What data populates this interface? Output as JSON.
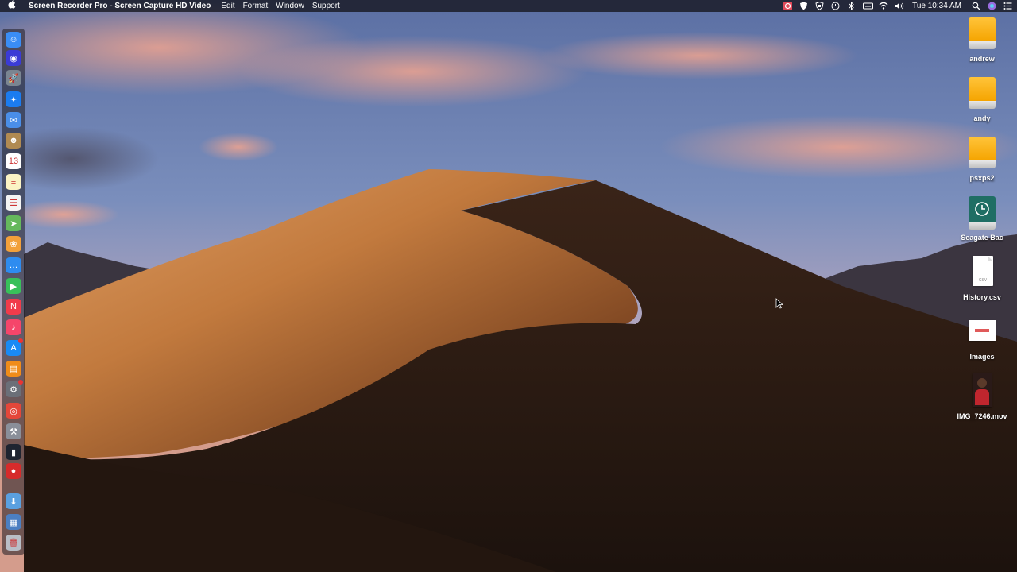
{
  "menubar": {
    "apple_icon": "apple-logo",
    "app_name": "Screen Recorder Pro - Screen Capture HD Video",
    "menus": [
      "Edit",
      "Format",
      "Window",
      "Support"
    ],
    "clock": "Tue 10:34 AM",
    "status_icons": [
      "screen-recorder-icon",
      "shield-icon",
      "vpn-icon",
      "time-machine-icon",
      "bluetooth-icon",
      "keyboard-icon",
      "wifi-icon",
      "volume-icon",
      "search-icon",
      "siri-icon",
      "notification-center-icon"
    ]
  },
  "dock": {
    "items": [
      {
        "name": "finder-icon",
        "color": "#3a8df5",
        "glyph": "☺"
      },
      {
        "name": "siri-icon",
        "color": "#3b3bd6",
        "glyph": "◉"
      },
      {
        "name": "launchpad-icon",
        "color": "#7a8591",
        "glyph": "🚀"
      },
      {
        "name": "safari-icon",
        "color": "#1b7cf0",
        "glyph": "✦"
      },
      {
        "name": "mail-icon",
        "color": "#4a8ee8",
        "glyph": "✉"
      },
      {
        "name": "contacts-icon",
        "color": "#b08a52",
        "glyph": "☻"
      },
      {
        "name": "calendar-icon",
        "color": "#ffffff",
        "glyph": "13"
      },
      {
        "name": "notes-icon",
        "color": "#fbf3c4",
        "glyph": "≡"
      },
      {
        "name": "reminders-icon",
        "color": "#f4f4f4",
        "glyph": "☰"
      },
      {
        "name": "maps-icon",
        "color": "#65b85c",
        "glyph": "➤"
      },
      {
        "name": "photos-icon",
        "color": "#f2a03a",
        "glyph": "❀"
      },
      {
        "name": "messages-icon",
        "color": "#2e8cf0",
        "glyph": "…"
      },
      {
        "name": "facetime-icon",
        "color": "#38c05a",
        "glyph": "▶"
      },
      {
        "name": "news-icon",
        "color": "#f13b4b",
        "glyph": "N"
      },
      {
        "name": "music-icon",
        "color": "#f5456a",
        "glyph": "♪"
      },
      {
        "name": "app-store-icon",
        "color": "#1a8af5",
        "glyph": "A"
      },
      {
        "name": "books-icon",
        "color": "#f08c1a",
        "glyph": "▤"
      },
      {
        "name": "system-preferences-icon",
        "color": "#6b6f78",
        "glyph": "⚙"
      },
      {
        "name": "chrome-icon",
        "color": "#e4473a",
        "glyph": "◎"
      },
      {
        "name": "utilities-icon",
        "color": "#8a8f99",
        "glyph": "⚒"
      },
      {
        "name": "activity-monitor-icon",
        "color": "#1f2430",
        "glyph": "▮"
      },
      {
        "name": "screen-recorder-icon",
        "color": "#d62b2b",
        "glyph": "●"
      },
      {
        "name": "downloads-folder-icon",
        "color": "#5aa0e0",
        "glyph": "⬇"
      },
      {
        "name": "documents-stack-icon",
        "color": "#4c7fc2",
        "glyph": "▦"
      },
      {
        "name": "trash-icon",
        "color": "#b9bec6",
        "glyph": "🗑"
      }
    ]
  },
  "desktop_icons": [
    {
      "label": "andrew",
      "type": "drive"
    },
    {
      "label": "andy",
      "type": "drive"
    },
    {
      "label": "psxps2",
      "type": "drive"
    },
    {
      "label": "Seagate Bac",
      "type": "backup"
    },
    {
      "label": "History.csv",
      "type": "csv",
      "doc_text": "CSV"
    },
    {
      "label": "Images",
      "type": "image"
    },
    {
      "label": "IMG_7246.mov",
      "type": "movie"
    }
  ]
}
